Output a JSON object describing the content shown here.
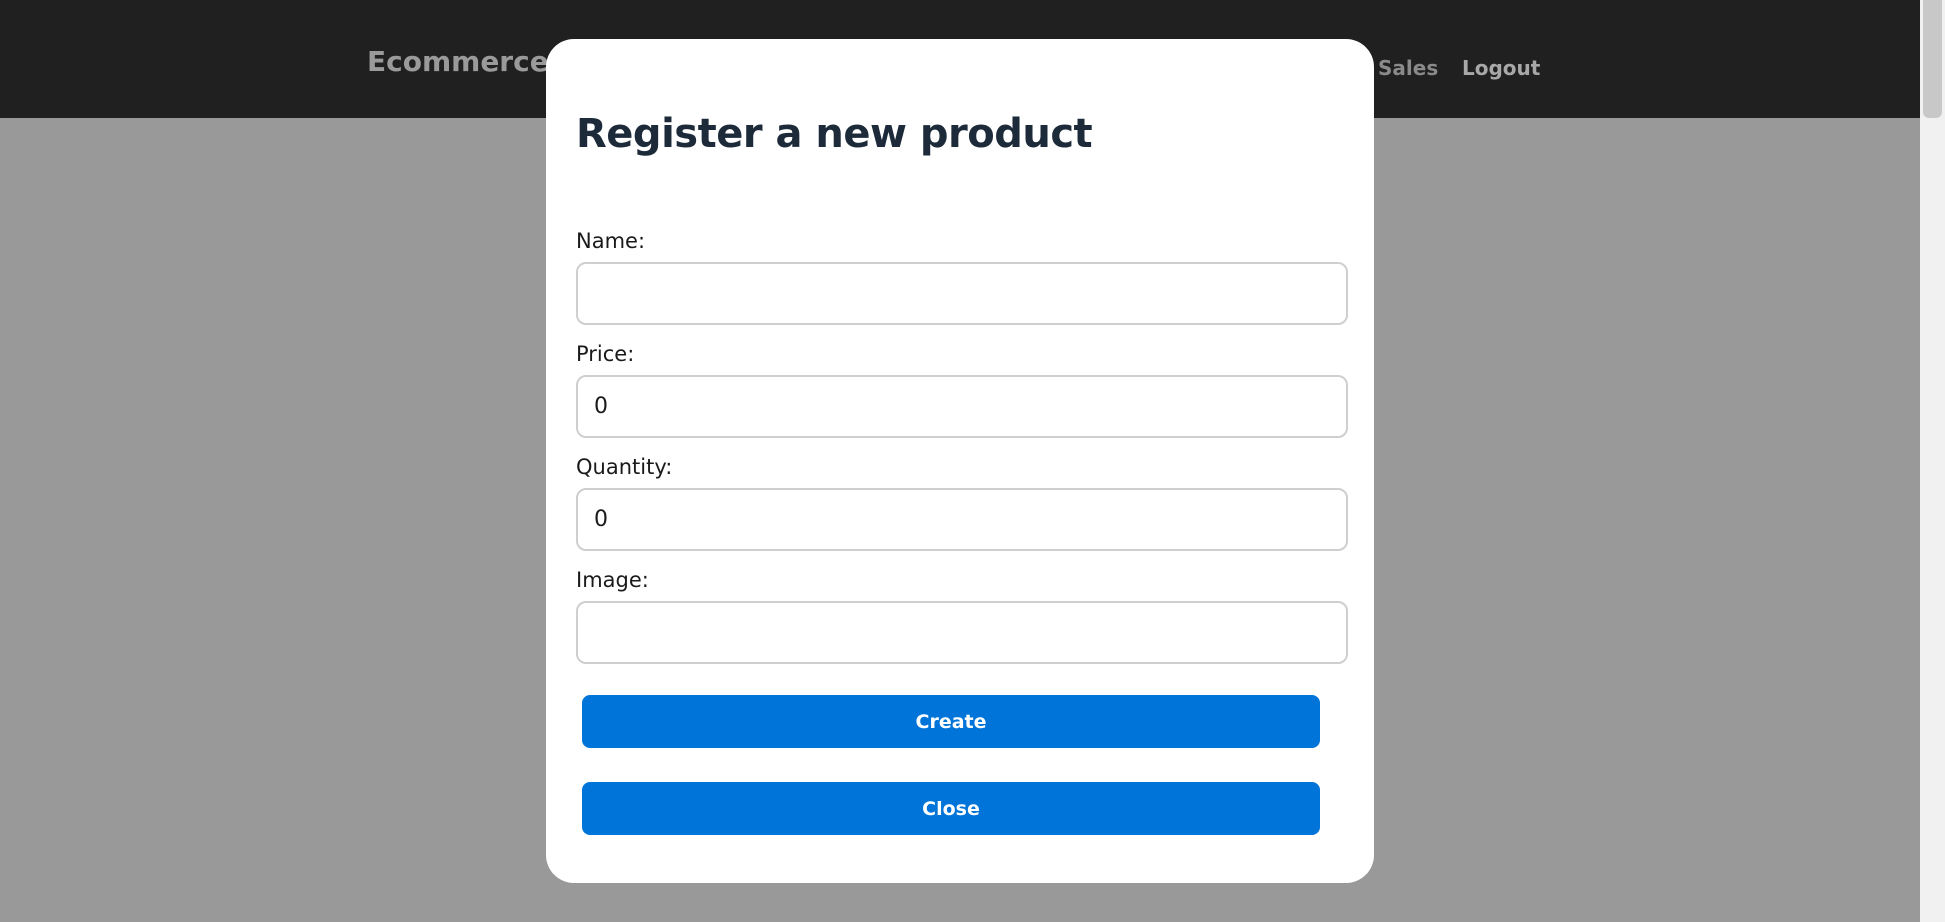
{
  "navbar": {
    "brand": "Ecommerce",
    "links": {
      "sales": "Sales",
      "logout": "Logout"
    }
  },
  "modal": {
    "title": "Register a new product",
    "fields": {
      "name": {
        "label": "Name:",
        "value": ""
      },
      "price": {
        "label": "Price:",
        "value": "0"
      },
      "quantity": {
        "label": "Quantity:",
        "value": "0"
      },
      "image": {
        "label": "Image:",
        "value": ""
      }
    },
    "buttons": {
      "create": "Create",
      "close": "Close"
    }
  },
  "colors": {
    "navbar_bg": "#202020",
    "overlay_bg": "#999999",
    "button_bg": "#0074d9",
    "title_color": "#1c2a3a"
  }
}
